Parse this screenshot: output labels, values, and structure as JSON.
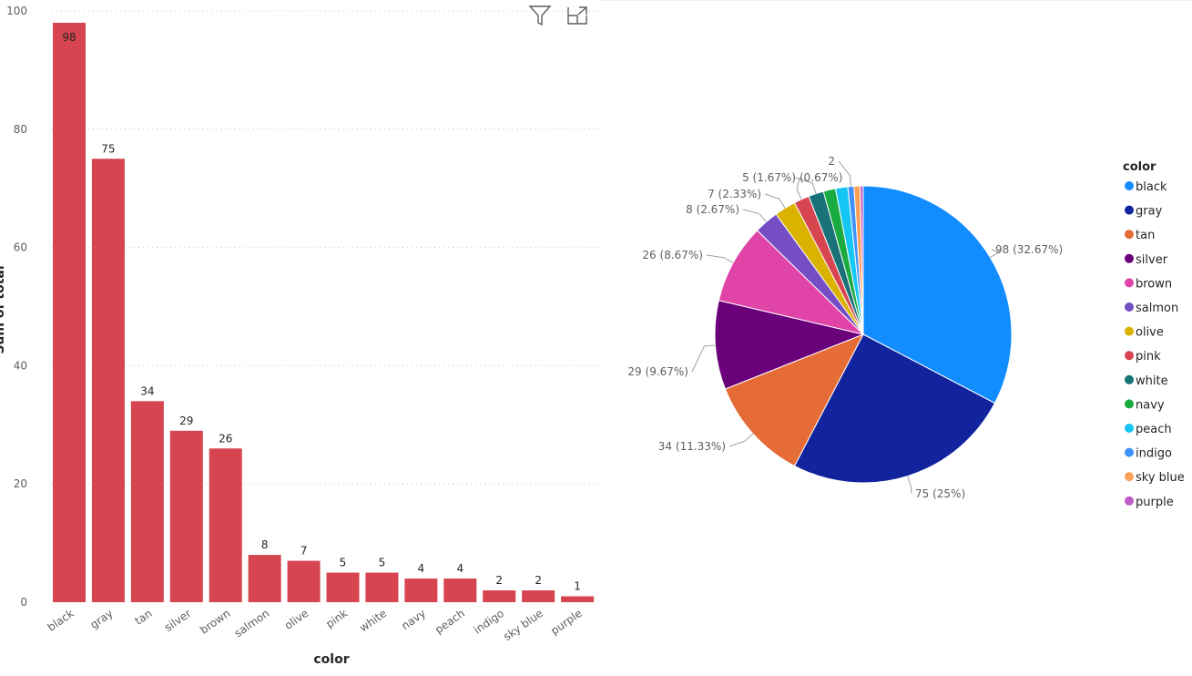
{
  "toolbar": {
    "filter_icon": "filter-icon",
    "focus_icon": "focus-mode-icon"
  },
  "chart_data": [
    {
      "type": "bar",
      "xlabel": "color",
      "ylabel": "Sum of total",
      "ylim": [
        0,
        100
      ],
      "yticks": [
        0,
        20,
        40,
        60,
        80,
        100
      ],
      "grid": true,
      "bar_color": "#D64550",
      "categories": [
        "black",
        "gray",
        "tan",
        "silver",
        "brown",
        "salmon",
        "olive",
        "pink",
        "white",
        "navy",
        "peach",
        "indigo",
        "sky blue",
        "purple"
      ],
      "values": [
        98,
        75,
        34,
        29,
        26,
        8,
        7,
        5,
        5,
        4,
        4,
        2,
        2,
        1
      ]
    },
    {
      "type": "pie",
      "legend_title": "color",
      "legend_position": "right",
      "categories": [
        "black",
        "gray",
        "tan",
        "silver",
        "brown",
        "salmon",
        "olive",
        "pink",
        "white",
        "navy",
        "peach",
        "indigo",
        "sky blue",
        "purple"
      ],
      "values": [
        98,
        75,
        34,
        29,
        26,
        8,
        7,
        5,
        5,
        4,
        4,
        2,
        2,
        1
      ],
      "colors": [
        "#118DFF",
        "#12239E",
        "#E66C37",
        "#6B007B",
        "#E044A7",
        "#744EC2",
        "#D9B300",
        "#D64550",
        "#197278",
        "#1AAB40",
        "#15C6F4",
        "#4092FF",
        "#FFA058",
        "#BE5DC9"
      ],
      "data_labels": [
        "98 (32.67%)",
        "75 (25%)",
        "34 (11.33%)",
        "29 (9.67%)",
        "26 (8.67%)",
        "8 (2.67%)",
        "7 (2.33%)",
        "5 (1.67%)",
        "(0.67%)",
        "2"
      ]
    }
  ]
}
